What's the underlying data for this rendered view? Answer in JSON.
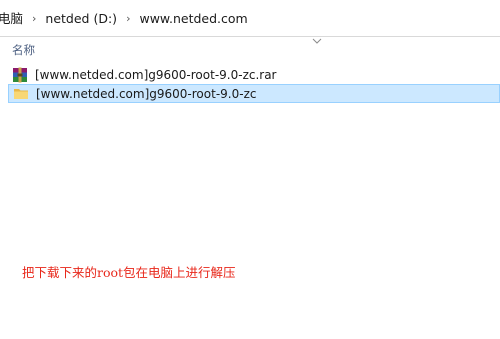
{
  "breadcrumb": {
    "items": [
      "电脑",
      "netded (D:)",
      "www.netded.com"
    ]
  },
  "header": {
    "name_column": "名称"
  },
  "files": [
    {
      "name": "[www.netded.com]g9600-root-9.0-zc.rar",
      "icon": "winrar-archive-icon",
      "selected": false
    },
    {
      "name": "[www.netded.com]g9600-root-9.0-zc",
      "icon": "folder-icon",
      "selected": true
    }
  ],
  "caption": "把下载下来的root包在电脑上进行解压",
  "colors": {
    "selection_bg": "#cce8ff",
    "selection_border": "#99d1ff",
    "caption": "#e8271a",
    "header_text": "#4d6082"
  }
}
